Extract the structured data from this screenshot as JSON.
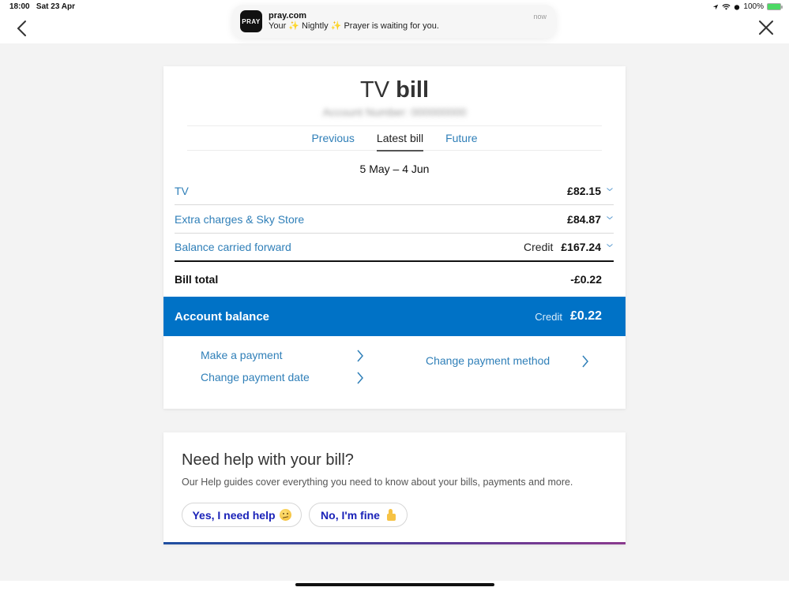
{
  "status_bar": {
    "time": "18:00",
    "date": "Sat 23 Apr",
    "battery": "100%",
    "icons": [
      "location-icon",
      "wifi-icon",
      "alarm-icon",
      "battery-charging-icon"
    ]
  },
  "notification": {
    "app_icon_text": "PRAY",
    "app": "pray.com",
    "message": "Your ✨ Nightly ✨  Prayer is waiting for you.",
    "time": "now"
  },
  "nav": {
    "back_icon": "chevron-left-icon",
    "close_icon": "close-icon"
  },
  "bill": {
    "title_light": "TV",
    "title_bold": "bill",
    "account_number_label": "Account Number: 000000000",
    "tabs": [
      {
        "label": "Previous",
        "active": false
      },
      {
        "label": "Latest bill",
        "active": true
      },
      {
        "label": "Future",
        "active": false
      }
    ],
    "period": "5 May – 4 Jun",
    "line_items": [
      {
        "label": "TV",
        "credit": "",
        "amount": "£82.15"
      },
      {
        "label": "Extra charges & Sky Store",
        "credit": "",
        "amount": "£84.87"
      },
      {
        "label": "Balance carried forward",
        "credit": "Credit",
        "amount": "£167.24"
      }
    ],
    "total": {
      "label": "Bill total",
      "amount": "-£0.22"
    },
    "account_balance": {
      "label": "Account balance",
      "credit": "Credit",
      "amount": "£0.22"
    },
    "actions": [
      {
        "label": "Make a payment"
      },
      {
        "label": "Change payment date"
      },
      {
        "label": "Change payment method"
      }
    ]
  },
  "help": {
    "title": "Need help with your bill?",
    "text": "Our Help guides cover everything you need to know about your bills, payments and more.",
    "yes_label": "Yes, I need help",
    "no_label": "No, I'm fine"
  },
  "colors": {
    "accent_blue": "#0072c6",
    "link_blue": "#2f7fb8",
    "button_text": "#1a22b8",
    "page_bg": "#f3f3f3"
  }
}
